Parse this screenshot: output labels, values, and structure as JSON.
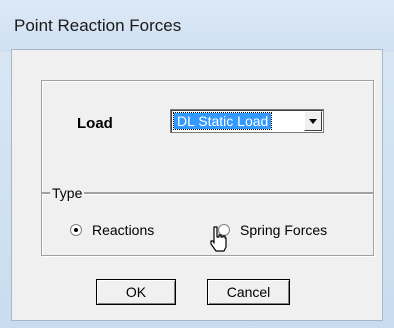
{
  "window": {
    "title": "Point Reaction Forces"
  },
  "load": {
    "label": "Load",
    "selected": "DL Static Load"
  },
  "type_group": {
    "legend": "Type",
    "options": [
      {
        "label": "Reactions",
        "checked": true
      },
      {
        "label": "Spring Forces",
        "checked": false
      }
    ]
  },
  "buttons": {
    "ok": "OK",
    "cancel": "Cancel"
  },
  "icons": {
    "dropdown": "chevron-down-icon",
    "cursor": "hand-pointer-icon"
  },
  "colors": {
    "selection_highlight": "#3399ff",
    "titlebar": "#cfe0f2",
    "dialog_face": "#f0f0f0"
  }
}
